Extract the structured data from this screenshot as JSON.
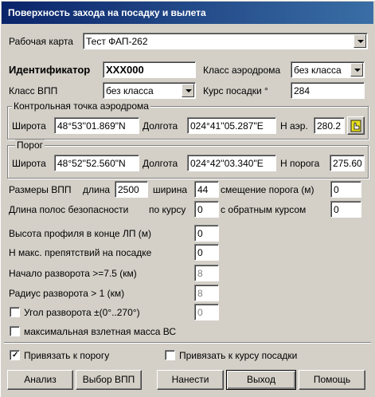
{
  "window": {
    "title": "Поверхность захода на посадку и вылета"
  },
  "work_map": {
    "label": "Рабочая карта",
    "value": "Тест ФАП-262"
  },
  "ident": {
    "label": "Идентификатор",
    "value": "XXX000"
  },
  "aerodrome_class": {
    "label": "Класс аэродрома",
    "value": "без класса"
  },
  "runway_class": {
    "label": "Класс ВПП",
    "value": "без класса"
  },
  "landing_course": {
    "label": "Курс посадки °",
    "value": "284"
  },
  "control_point": {
    "legend": "Контрольная точка аэродрома",
    "lat_label": "Широта",
    "lat": "48°53''01.869\"N",
    "lon_label": "Долгота",
    "lon": "024°41''05.287\"E",
    "h_label": "H аэр.",
    "h": "280.2",
    "pick_icon": "hand-pointer-icon"
  },
  "threshold": {
    "legend": "Порог",
    "lat_label": "Широта",
    "lat": "48°52''52.560\"N",
    "lon_label": "Долгота",
    "lon": "024°42''03.340\"E",
    "h_label": "H порога",
    "h": "275.60"
  },
  "runway_size": {
    "label": "Размеры ВПП",
    "length_label": "длина",
    "length": "2500",
    "width_label": "ширина",
    "width": "44",
    "offset_label": "смещение порога (м)",
    "offset": "0"
  },
  "safety_strip": {
    "label": "Длина полос безопасности",
    "course_label": "по курсу",
    "course": "0",
    "reverse_label": "с обратным курсом",
    "reverse": "0"
  },
  "profile_height": {
    "label": "Высота профиля в конце ЛП (м)",
    "value": "0"
  },
  "max_obstacle": {
    "label": "Н макс. препятствий на посадке",
    "value": "0"
  },
  "turn_start": {
    "label": "Начало разворота >=7.5 (км)",
    "value": "8"
  },
  "turn_radius": {
    "label": "Радиус разворота > 1 (км)",
    "value": "8"
  },
  "turn_angle": {
    "label": "Угол разворота ±(0°..270°)",
    "value": "0",
    "checked": false
  },
  "max_takeoff": {
    "label": "максимальная взлетная масса ВС",
    "checked": false
  },
  "bind_threshold": {
    "label": "Привязать к порогу",
    "checked": true
  },
  "bind_course": {
    "label": "Привязать к курсу посадки",
    "checked": false
  },
  "buttons": {
    "analyze": "Анализ",
    "select_runway": "Выбор ВПП",
    "apply": "Нанести",
    "exit": "Выход",
    "help": "Помощь"
  }
}
